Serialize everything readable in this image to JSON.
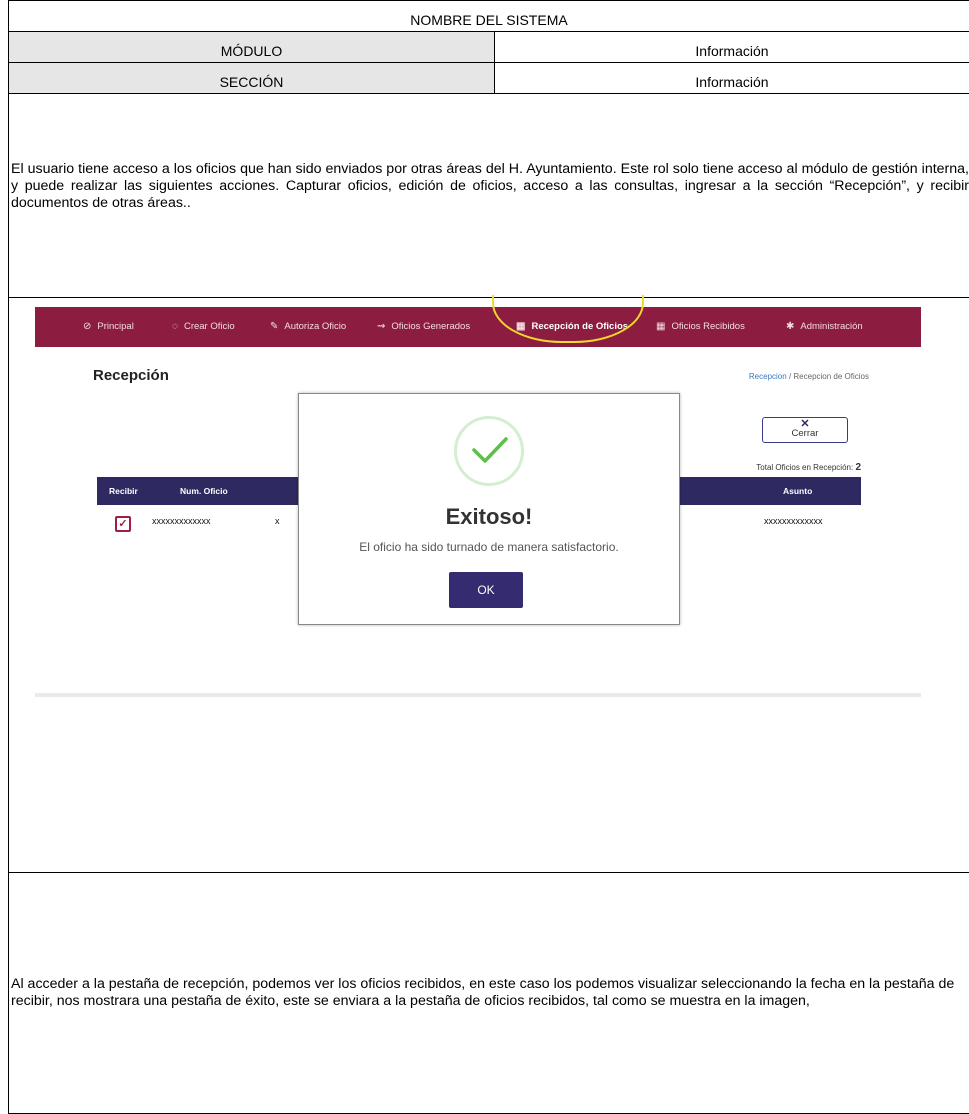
{
  "header": {
    "system_name": "NOMBRE DEL SISTEMA",
    "module_label": "MÓDULO",
    "module_value": "Información",
    "section_label": "SECCIÓN",
    "section_value": "Información"
  },
  "description": "El usuario tiene acceso a los oficios que han sido enviados por otras áreas del H. Ayuntamiento. Este rol solo tiene acceso al módulo de gestión interna, y puede realizar las siguientes acciones. Capturar oficios, edición de oficios, acceso a las consultas, ingresar a la sección “Recepción”, y recibir documentos de otras áreas..",
  "screenshot": {
    "nav": [
      {
        "icon": "⊘",
        "icon_name": "compass-icon",
        "label": "Principal"
      },
      {
        "icon": "◌",
        "icon_name": "refresh-icon",
        "label": "Crear Oficio"
      },
      {
        "icon": "✎",
        "icon_name": "edit-icon",
        "label": "Autoriza Oficio"
      },
      {
        "icon": "⇝",
        "icon_name": "share-icon",
        "label": "Oficios Generados"
      },
      {
        "icon": "▦",
        "icon_name": "table-icon",
        "label": "Recepción de Oficios"
      },
      {
        "icon": "▦",
        "icon_name": "table-icon",
        "label": "Oficios Recibidos"
      },
      {
        "icon": "✱",
        "icon_name": "gear-icon",
        "label": "Administración"
      }
    ],
    "page_title": "Recepción",
    "breadcrumb_link": "Recepcion",
    "breadcrumb_sep": "/",
    "breadcrumb_current": "Recepcion de Oficios",
    "close_label": "Cerrar",
    "total_label": "Total Oficios en Recepción:",
    "total_value": "2",
    "columns": {
      "recibir": "Recibir",
      "num_oficio": "Num. Oficio",
      "asunto": "Asunto"
    },
    "row": {
      "num_oficio": "xxxxxxxxxxxxx",
      "col3": "x",
      "asunto": "xxxxxxxxxxxxx"
    },
    "modal": {
      "title": "Exitoso!",
      "message": "El oficio ha sido turnado de manera satisfactorio.",
      "ok_label": "OK"
    },
    "colors": {
      "nav": "#8c1c40",
      "table_header": "#2e2960",
      "highlight": "#f2d82b",
      "success": "#5cc04b"
    }
  },
  "footer_text": "Al acceder a la pestaña de recepción, podemos ver los oficios recibidos, en este caso los podemos visualizar seleccionando la fecha en la pestaña de recibir, nos mostrara una pestaña de éxito, este se enviara a la pestaña de oficios recibidos, tal como se muestra en la imagen,"
}
